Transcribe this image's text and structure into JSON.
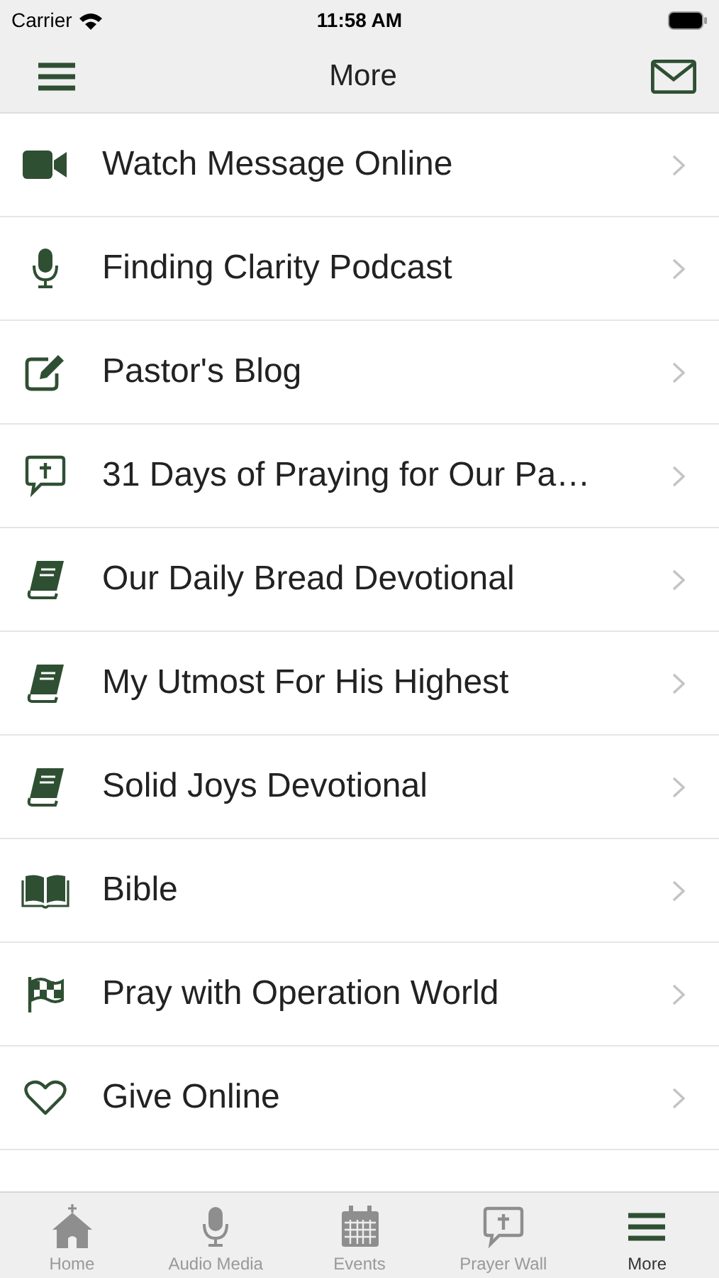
{
  "status_bar": {
    "carrier": "Carrier",
    "time": "11:58 AM"
  },
  "nav_bar": {
    "title": "More"
  },
  "menu_items": [
    {
      "label": "Watch Message Online",
      "kind": "video"
    },
    {
      "label": "Finding Clarity Podcast",
      "kind": "mic"
    },
    {
      "label": "Pastor's Blog",
      "kind": "edit"
    },
    {
      "label": "31 Days of Praying for Our Pa…",
      "kind": "bubble"
    },
    {
      "label": "Our Daily Bread Devotional",
      "kind": "book"
    },
    {
      "label": "My Utmost For His Highest",
      "kind": "book"
    },
    {
      "label": "Solid Joys Devotional",
      "kind": "book"
    },
    {
      "label": "Bible",
      "kind": "openbook"
    },
    {
      "label": "Pray with Operation World",
      "kind": "flag"
    },
    {
      "label": "Give Online",
      "kind": "heart"
    }
  ],
  "tab_bar": [
    {
      "label": "Home",
      "kind": "church",
      "selected": false
    },
    {
      "label": "Audio Media",
      "kind": "mic",
      "selected": false
    },
    {
      "label": "Events",
      "kind": "calendar",
      "selected": false
    },
    {
      "label": "Prayer Wall",
      "kind": "bubble",
      "selected": false
    },
    {
      "label": "More",
      "kind": "menu",
      "selected": true
    }
  ]
}
